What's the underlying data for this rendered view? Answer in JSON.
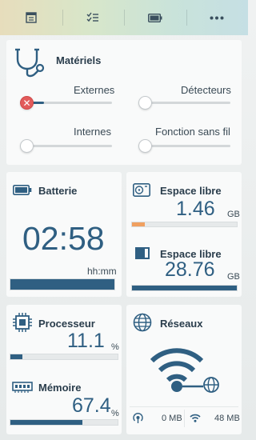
{
  "toolbar": {
    "tabs": [
      {
        "icon": "dashboard-icon"
      },
      {
        "icon": "checklist-icon"
      },
      {
        "icon": "battery-icon"
      },
      {
        "icon": "more-icon"
      }
    ]
  },
  "hardware": {
    "title": "Matériels",
    "external_label": "Externes",
    "external_level": 0.2,
    "detectors_label": "Détecteurs",
    "detectors_level": 0,
    "internal_label": "Internes",
    "internal_level": 0,
    "wireless_label": "Fonction sans fil",
    "wireless_level": 0
  },
  "battery": {
    "title": "Batterie",
    "time": "02:58",
    "unit": "hh:mm",
    "level": 1.0
  },
  "storage1": {
    "title": "Espace libre",
    "value": "1.46",
    "unit": "GB",
    "level": 0.12,
    "color": "#f0a060"
  },
  "storage2": {
    "title": "Espace libre",
    "value": "28.76",
    "unit": "GB",
    "level": 1.0,
    "color": "#2f5f82"
  },
  "processor": {
    "title": "Processeur",
    "value": "11.1",
    "unit": "%",
    "level": 0.111
  },
  "memory": {
    "title": "Mémoire",
    "value": "67.4",
    "unit": "%",
    "level": 0.674
  },
  "network": {
    "title": "Réseaux",
    "upload": "0 MB",
    "download": "48 MB"
  },
  "colors": {
    "accent": "#2f5f82",
    "warning": "#e25b5b"
  }
}
